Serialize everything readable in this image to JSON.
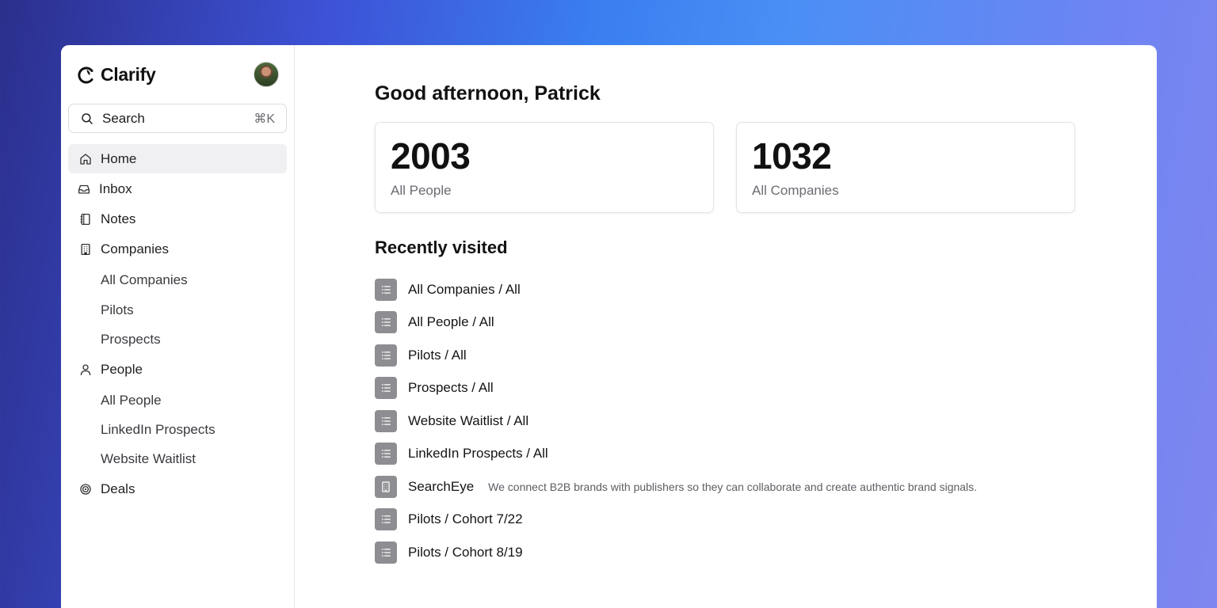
{
  "app": {
    "name": "Clarify"
  },
  "user": {
    "avatar_alt": "Patrick"
  },
  "search": {
    "label": "Search",
    "shortcut": "⌘K"
  },
  "sidebar": {
    "items": [
      {
        "label": "Home",
        "icon": "home-icon",
        "active": true
      },
      {
        "label": "Inbox",
        "icon": "inbox-icon"
      },
      {
        "label": "Notes",
        "icon": "notebook-icon"
      },
      {
        "label": "Companies",
        "icon": "building-icon"
      },
      {
        "label": "All Companies"
      },
      {
        "label": "Pilots"
      },
      {
        "label": "Prospects"
      },
      {
        "label": "People",
        "icon": "person-icon"
      },
      {
        "label": "All People"
      },
      {
        "label": "LinkedIn Prospects"
      },
      {
        "label": "Website Waitlist"
      },
      {
        "label": "Deals",
        "icon": "target-icon"
      }
    ]
  },
  "main": {
    "greeting": "Good afternoon, Patrick",
    "stats": [
      {
        "value": "2003",
        "label": "All People"
      },
      {
        "value": "1032",
        "label": "All Companies"
      }
    ],
    "recent_title": "Recently visited",
    "recent": [
      {
        "label": "All Companies / All",
        "icon": "list-icon"
      },
      {
        "label": "All People / All",
        "icon": "list-icon"
      },
      {
        "label": "Pilots / All",
        "icon": "list-icon"
      },
      {
        "label": "Prospects / All",
        "icon": "list-icon"
      },
      {
        "label": "Website Waitlist / All",
        "icon": "list-icon"
      },
      {
        "label": "LinkedIn Prospects / All",
        "icon": "list-icon"
      },
      {
        "label": "SearchEye",
        "icon": "building-icon",
        "description": "We connect B2B brands with publishers so they can collaborate and create authentic brand signals."
      },
      {
        "label": "Pilots / Cohort 7/22",
        "icon": "list-icon"
      },
      {
        "label": "Pilots / Cohort 8/19",
        "icon": "list-icon"
      }
    ]
  }
}
